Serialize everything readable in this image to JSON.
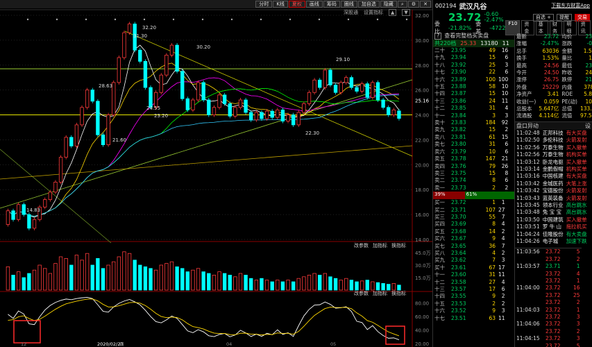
{
  "toolbar": {
    "buttons": [
      "分时",
      "K线",
      "夏权",
      "画线",
      "筹码",
      "圈线",
      "加自选",
      "隐藏"
    ],
    "selected": "夏权",
    "icons": [
      "search-icon",
      "gear-icon",
      "close-icon"
    ]
  },
  "subtabs": [
    "深股通",
    "设置指标"
  ],
  "indicator_bars": [
    {
      "items": [
        "改参数",
        "加指标",
        "换指标"
      ]
    },
    {
      "items": [
        "改参数",
        "加指标",
        "换指标"
      ]
    }
  ],
  "price_axis": [
    "32.00",
    "30.00",
    "28.00",
    "26.00",
    "25.16",
    "24.00",
    "22.00",
    "20.00",
    "18.00",
    "16.00",
    "14.00"
  ],
  "vol_axis": [
    "45.0万",
    "30.0万",
    "15.0万"
  ],
  "kdj_axis": [
    "80.00",
    "60.00",
    "40.00",
    "20.00"
  ],
  "x_axis": [
    "12",
    "2020/02/20",
    "四",
    "04",
    "05"
  ],
  "chart_annotations": {
    "high": "32.20",
    "h2": "31.30",
    "h3": "30.20",
    "h4": "29.10",
    "h5": "28.63",
    "l1": "24.55",
    "l2": "22.30",
    "l3": "21.60",
    "low": "14.83",
    "l4": "23.20"
  },
  "stock": {
    "code": "002194",
    "name": "武汉凡谷",
    "price": "23.72",
    "change": "-0.60",
    "change_pct": "-2.47%",
    "app_link": "下载东方财富App"
  },
  "actions": {
    "add": "自选 +",
    "alert": "提醒",
    "trade": "交易"
  },
  "tabs": [
    "F10",
    "资金",
    "基本",
    "财务",
    "明细",
    "资讯"
  ],
  "ratio": {
    "wb_label": "委比",
    "wb_val": "-21.82%",
    "wc_label": "委差",
    "wc_val": "-4722"
  },
  "order_notice": {
    "text": "查看完整档买卖盘",
    "count_label": "共220档",
    "ask": "25.33",
    "vol": "13180",
    "n": "11"
  },
  "stats": [
    [
      "最新",
      "23.72",
      "均价",
      "23.79"
    ],
    [
      "涨幅",
      "-2.47%",
      "涨跌",
      "-0.60"
    ],
    [
      "总手",
      "63036",
      "金额",
      "1.50亿"
    ],
    [
      "换手",
      "1.53%",
      "量比",
      "1.23"
    ],
    [
      "最高",
      "24.56",
      "最低",
      "23.33"
    ],
    [
      "今开",
      "24.50",
      "昨收",
      "24.32"
    ],
    [
      "涨停",
      "26.75",
      "跌停",
      "21.89"
    ],
    [
      "外盘",
      "25229",
      "内盘",
      "37807"
    ],
    [
      "净资产",
      "3.41",
      "ROE",
      "5.85%"
    ],
    [
      "收益(一)",
      "0.059",
      "PE(动)",
      "100.3"
    ],
    [
      "总股本",
      "5.647亿",
      "总值",
      "133.9亿"
    ],
    [
      "流通股",
      "4.114亿",
      "流值",
      "97.59亿"
    ]
  ],
  "asks": [
    [
      "二十",
      "23.95",
      "49",
      "16"
    ],
    [
      "十九",
      "23.94",
      "15",
      "6"
    ],
    [
      "十八",
      "23.92",
      "25",
      "3"
    ],
    [
      "十七",
      "23.90",
      "22",
      "6"
    ],
    [
      "十六",
      "23.89",
      "100",
      "100"
    ],
    [
      "十五",
      "23.88",
      "58",
      "10"
    ],
    [
      "十四",
      "23.87",
      "15",
      "10"
    ],
    [
      "十三",
      "23.86",
      "24",
      "11"
    ],
    [
      "十二",
      "23.85",
      "31",
      "4"
    ],
    [
      "十一",
      "23.84",
      "3",
      "3"
    ],
    [
      "卖十",
      "23.83",
      "184",
      "92"
    ],
    [
      "卖九",
      "23.82",
      "15",
      "2"
    ],
    [
      "卖八",
      "23.81",
      "61",
      "15"
    ],
    [
      "卖七",
      "23.80",
      "31",
      "6"
    ],
    [
      "卖六",
      "23.79",
      "10",
      "6"
    ],
    [
      "卖五",
      "23.78",
      "147",
      "21"
    ],
    [
      "卖四",
      "23.76",
      "79",
      "26"
    ],
    [
      "卖三",
      "23.75",
      "15",
      "8"
    ],
    [
      "卖二",
      "23.74",
      "8",
      "6"
    ],
    [
      "卖一",
      "23.73",
      "2",
      "2"
    ]
  ],
  "bidask_ratio": {
    "left": "39%",
    "right": "61%"
  },
  "bids": [
    [
      "买一",
      "23.72",
      "1",
      "1"
    ],
    [
      "买二",
      "23.71",
      "107",
      "27"
    ],
    [
      "买三",
      "23.70",
      "55",
      "7"
    ],
    [
      "买四",
      "23.69",
      "8",
      "4"
    ],
    [
      "买五",
      "23.68",
      "14",
      "2"
    ],
    [
      "买六",
      "23.67",
      "9",
      "4"
    ],
    [
      "买七",
      "23.65",
      "36",
      "7"
    ],
    [
      "买八",
      "23.64",
      "4",
      "2"
    ],
    [
      "买九",
      "23.62",
      "7",
      "3"
    ],
    [
      "买十",
      "23.61",
      "67",
      "17"
    ],
    [
      "十一",
      "23.60",
      "31",
      "11"
    ],
    [
      "十二",
      "23.58",
      "27",
      "4"
    ],
    [
      "十三",
      "23.57",
      "17",
      "6"
    ],
    [
      "十四",
      "23.55",
      "9",
      "2"
    ],
    [
      "十五",
      "23.53",
      "2",
      "2"
    ],
    [
      "十六",
      "23.52",
      "9",
      "3"
    ],
    [
      "十七",
      "23.51",
      "63",
      "11"
    ]
  ],
  "moves_header": {
    "title": "盘口异动",
    "more": "设"
  },
  "moves": [
    [
      "11:02:48",
      "正邦科技",
      "有大买盘",
      "red"
    ],
    [
      "11:02:50",
      "多伦科技",
      "火箭发射",
      "red"
    ],
    [
      "11:02:56",
      "万泰生物",
      "买入撤单",
      "red"
    ],
    [
      "11:02:56",
      "万泰生物",
      "机构买单",
      "red"
    ],
    [
      "11:03:12",
      "卧龙电驱",
      "买入撤单",
      "red"
    ],
    [
      "11:03:14",
      "金鹏假帽",
      "机构买单",
      "red"
    ],
    [
      "11:03:16",
      "中国核建",
      "有大买盘",
      "red"
    ],
    [
      "11:03:42",
      "金城医药",
      "大笔上涨",
      "red"
    ],
    [
      "11:03:42",
      "宝德股份",
      "火箭发射",
      "red"
    ],
    [
      "11:03:43",
      "蓝英装备",
      "火箭发射",
      "red"
    ],
    [
      "11:03:45",
      "领本行业",
      "高台跳水",
      "green"
    ],
    [
      "11:03:48",
      "兔 宝 宝",
      "高台跳水",
      "green"
    ],
    [
      "11:03:50",
      "中国建筑",
      "买入撤单",
      "red"
    ],
    [
      "11:03:51",
      "罗 牛 山",
      "拖拉机买",
      "red"
    ],
    [
      "11:04:24",
      "佳隆股份",
      "有大卖盘",
      "green"
    ],
    [
      "11:04:26",
      "电子城",
      "加速下跌",
      "green"
    ]
  ],
  "ticks": [
    [
      "11:03:56",
      "23.72",
      "5",
      "red"
    ],
    [
      "",
      "23.72",
      "2",
      "red"
    ],
    [
      "11:03:57",
      "23.71",
      "1",
      "green"
    ],
    [
      "",
      "23.72",
      "4",
      "red"
    ],
    [
      "",
      "23.72",
      "1",
      "red"
    ],
    [
      "11:04:00",
      "23.72",
      "16",
      "red"
    ],
    [
      "",
      "23.72",
      "25",
      "red"
    ],
    [
      "",
      "23.72",
      "2",
      "red"
    ],
    [
      "11:04:03",
      "23.72",
      "1",
      "red"
    ],
    [
      "",
      "23.72",
      "3",
      "red"
    ],
    [
      "11:04:06",
      "23.72",
      "3",
      "red"
    ],
    [
      "",
      "23.72",
      "2",
      "red"
    ],
    [
      "11:04:15",
      "23.72",
      "3",
      "red"
    ],
    [
      "",
      "23.72",
      "5",
      "red"
    ],
    [
      "",
      "23.72",
      "1",
      "red"
    ],
    [
      "",
      "23.72",
      "2",
      "red"
    ]
  ],
  "chart_data": {
    "type": "candlestick",
    "candles": [
      {
        "o": 15.2,
        "c": 16.3
      },
      {
        "o": 16.3,
        "c": 15.6
      },
      {
        "o": 15.6,
        "c": 16.8
      },
      {
        "o": 16.8,
        "c": 16.0
      },
      {
        "o": 16.0,
        "c": 14.9
      },
      {
        "o": 14.9,
        "c": 15.6
      },
      {
        "o": 15.6,
        "c": 16.6
      },
      {
        "o": 16.6,
        "c": 17.2
      },
      {
        "o": 17.2,
        "c": 17.8
      },
      {
        "o": 17.8,
        "c": 18.6
      },
      {
        "o": 18.6,
        "c": 20.6
      },
      {
        "o": 20.6,
        "c": 22.2
      },
      {
        "o": 22.2,
        "c": 21.5
      },
      {
        "o": 21.5,
        "c": 23.2
      },
      {
        "o": 23.2,
        "c": 24.6
      },
      {
        "o": 24.6,
        "c": 26.0
      },
      {
        "o": 26.0,
        "c": 25.1
      },
      {
        "o": 25.1,
        "c": 22.4
      },
      {
        "o": 22.4,
        "c": 21.6
      },
      {
        "o": 21.6,
        "c": 24.0
      },
      {
        "o": 24.0,
        "c": 26.6
      },
      {
        "o": 26.6,
        "c": 28.6
      },
      {
        "o": 28.6,
        "c": 30.6
      },
      {
        "o": 30.6,
        "c": 31.3
      },
      {
        "o": 31.3,
        "c": 29.2
      },
      {
        "o": 29.2,
        "c": 28.3
      },
      {
        "o": 28.3,
        "c": 26.2
      },
      {
        "o": 26.2,
        "c": 24.6
      },
      {
        "o": 24.6,
        "c": 25.8
      },
      {
        "o": 25.8,
        "c": 27.2
      },
      {
        "o": 27.2,
        "c": 28.8
      },
      {
        "o": 28.8,
        "c": 29.6
      },
      {
        "o": 29.6,
        "c": 27.5
      },
      {
        "o": 27.5,
        "c": 25.3
      },
      {
        "o": 25.3,
        "c": 24.4
      },
      {
        "o": 24.4,
        "c": 25.2
      },
      {
        "o": 25.2,
        "c": 26.6
      },
      {
        "o": 26.6,
        "c": 25.2
      },
      {
        "o": 25.2,
        "c": 24.0
      },
      {
        "o": 24.0,
        "c": 24.6
      },
      {
        "o": 24.6,
        "c": 25.6
      },
      {
        "o": 25.6,
        "c": 24.9
      },
      {
        "o": 24.9,
        "c": 23.9
      },
      {
        "o": 23.9,
        "c": 24.6
      },
      {
        "o": 24.6,
        "c": 25.2
      },
      {
        "o": 25.2,
        "c": 24.2
      },
      {
        "o": 24.2,
        "c": 23.6
      },
      {
        "o": 23.6,
        "c": 24.2
      },
      {
        "o": 24.2,
        "c": 23.7
      },
      {
        "o": 23.7,
        "c": 24.3
      },
      {
        "o": 24.3,
        "c": 23.8
      },
      {
        "o": 23.8,
        "c": 24.4
      },
      {
        "o": 24.4,
        "c": 23.5
      },
      {
        "o": 23.5,
        "c": 24.0
      },
      {
        "o": 24.0,
        "c": 23.2
      },
      {
        "o": 23.2,
        "c": 24.2
      },
      {
        "o": 24.2,
        "c": 24.9
      },
      {
        "o": 24.9,
        "c": 25.8
      },
      {
        "o": 25.8,
        "c": 26.8
      },
      {
        "o": 26.8,
        "c": 26.2
      },
      {
        "o": 26.2,
        "c": 27.6
      },
      {
        "o": 27.6,
        "c": 26.4
      },
      {
        "o": 26.4,
        "c": 25.8
      },
      {
        "o": 25.8,
        "c": 26.6
      },
      {
        "o": 26.6,
        "c": 27.0
      },
      {
        "o": 27.0,
        "c": 26.2
      },
      {
        "o": 26.2,
        "c": 25.9
      },
      {
        "o": 25.9,
        "c": 26.5
      },
      {
        "o": 26.5,
        "c": 25.4
      },
      {
        "o": 25.4,
        "c": 26.6
      },
      {
        "o": 26.6,
        "c": 25.2
      },
      {
        "o": 25.2,
        "c": 24.6
      },
      {
        "o": 24.6,
        "c": 24.0
      },
      {
        "o": 24.0,
        "c": 24.4
      },
      {
        "o": 24.32,
        "c": 23.72
      }
    ],
    "volumes": [
      28,
      18,
      22,
      15,
      20,
      24,
      30,
      26,
      20,
      32,
      40,
      38,
      30,
      42,
      36,
      44,
      30,
      38,
      26,
      30,
      34,
      40,
      46,
      44,
      36,
      30,
      28,
      26,
      24,
      30,
      32,
      34,
      28,
      26,
      22,
      24,
      26,
      22,
      20,
      18,
      22,
      20,
      18,
      16,
      20,
      18,
      14,
      12,
      14,
      12,
      10,
      12,
      10,
      12,
      10,
      14,
      16,
      18,
      20,
      18,
      20,
      16,
      14,
      12,
      14,
      12,
      10,
      11,
      12,
      10,
      9,
      8,
      7,
      8,
      6
    ],
    "ylim": [
      14,
      32
    ],
    "vol_ylim": [
      0,
      50
    ],
    "kdj_ylim": [
      20,
      90
    ]
  }
}
